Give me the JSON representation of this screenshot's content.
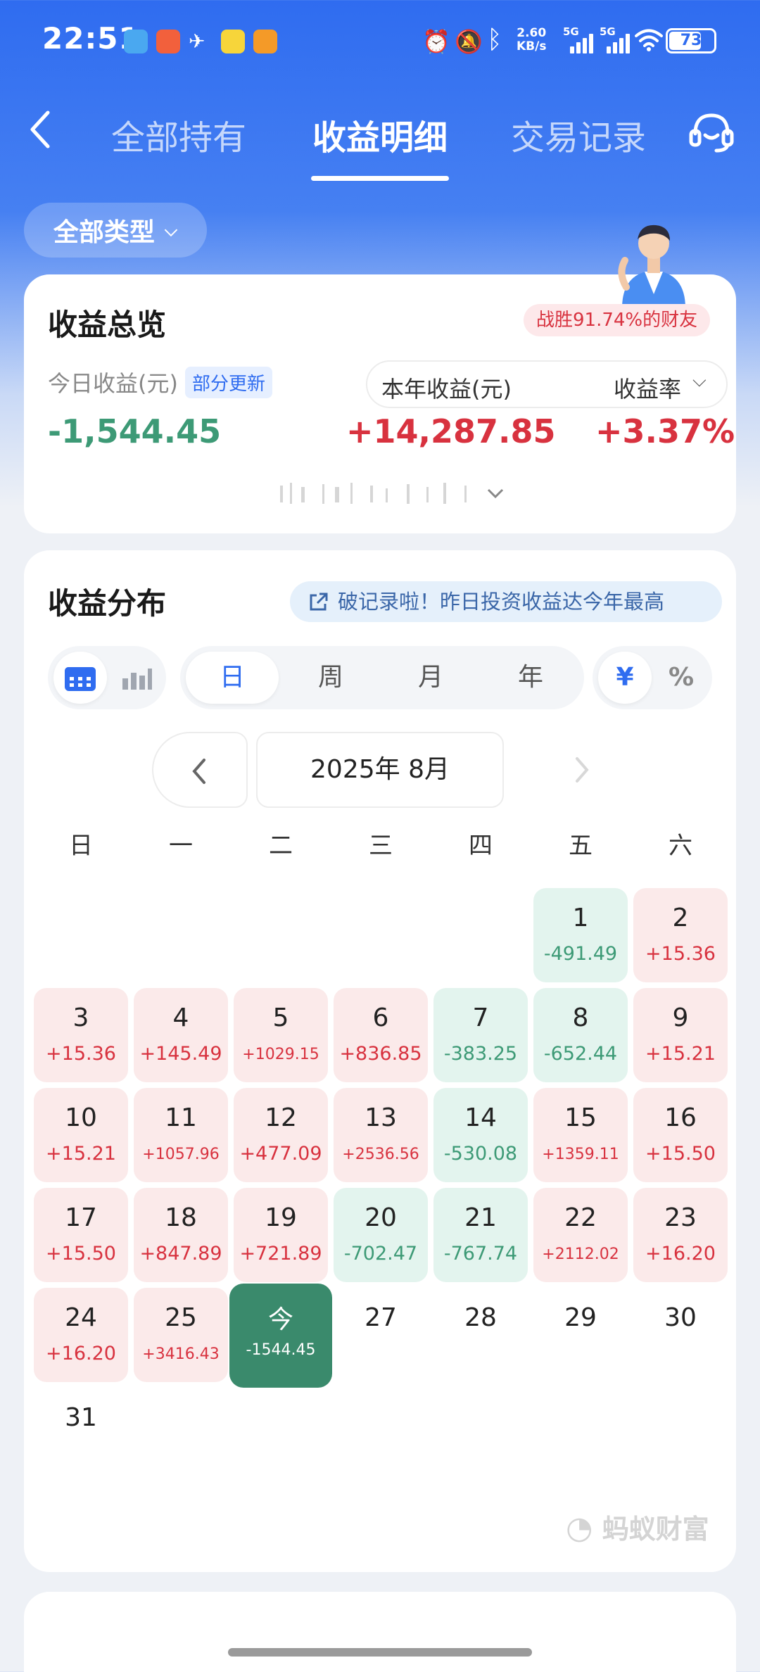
{
  "status": {
    "time": "22:51",
    "speed_value": "2.60",
    "speed_unit": "KB/s",
    "signal1": "5G",
    "signal2": "5G",
    "battery": "73",
    "battery_level": 0.73
  },
  "header": {
    "tabs": [
      "全部持有",
      "收益明细",
      "交易记录"
    ],
    "active_tab": 1
  },
  "filter": {
    "label": "全部类型"
  },
  "overview": {
    "title": "收益总览",
    "rank_badge": "战胜91.74%的财友",
    "today_label": "今日收益(元)",
    "today_tag": "部分更新",
    "today_value": "-1,544.45",
    "year_label": "本年收益(元)",
    "rate_label": "收益率",
    "year_value": "+14,287.85",
    "rate_value": "+3.37%"
  },
  "distribution": {
    "title": "收益分布",
    "banner": "破记录啦！昨日投资收益达今年最高",
    "period_tabs": [
      "日",
      "周",
      "月",
      "年"
    ],
    "unit_tabs": [
      "¥",
      "%"
    ],
    "month": "2025年 8月",
    "weekdays": [
      "日",
      "一",
      "二",
      "三",
      "四",
      "五",
      "六"
    ],
    "days": [
      {
        "n": "1",
        "v": "-491.49"
      },
      {
        "n": "2",
        "v": "+15.36"
      },
      {
        "n": "3",
        "v": "+15.36"
      },
      {
        "n": "4",
        "v": "+145.49"
      },
      {
        "n": "5",
        "v": "+1029.15"
      },
      {
        "n": "6",
        "v": "+836.85"
      },
      {
        "n": "7",
        "v": "-383.25"
      },
      {
        "n": "8",
        "v": "-652.44"
      },
      {
        "n": "9",
        "v": "+15.21"
      },
      {
        "n": "10",
        "v": "+15.21"
      },
      {
        "n": "11",
        "v": "+1057.96"
      },
      {
        "n": "12",
        "v": "+477.09"
      },
      {
        "n": "13",
        "v": "+2536.56"
      },
      {
        "n": "14",
        "v": "-530.08"
      },
      {
        "n": "15",
        "v": "+1359.11"
      },
      {
        "n": "16",
        "v": "+15.50"
      },
      {
        "n": "17",
        "v": "+15.50"
      },
      {
        "n": "18",
        "v": "+847.89"
      },
      {
        "n": "19",
        "v": "+721.89"
      },
      {
        "n": "20",
        "v": "-702.47"
      },
      {
        "n": "21",
        "v": "-767.74"
      },
      {
        "n": "22",
        "v": "+2112.02"
      },
      {
        "n": "23",
        "v": "+16.20"
      },
      {
        "n": "24",
        "v": "+16.20"
      },
      {
        "n": "25",
        "v": "+3416.43"
      },
      {
        "n": "今",
        "v": "-1544.45"
      },
      {
        "n": "27",
        "v": ""
      },
      {
        "n": "28",
        "v": ""
      },
      {
        "n": "29",
        "v": ""
      },
      {
        "n": "30",
        "v": ""
      },
      {
        "n": "31",
        "v": ""
      }
    ],
    "watermark": "蚂蚁财富"
  },
  "colors": {
    "brand_blue": "#2f6cf0",
    "gain_red": "#d8323f",
    "loss_green": "#3d9a76",
    "today_green": "#3a8a6c"
  }
}
